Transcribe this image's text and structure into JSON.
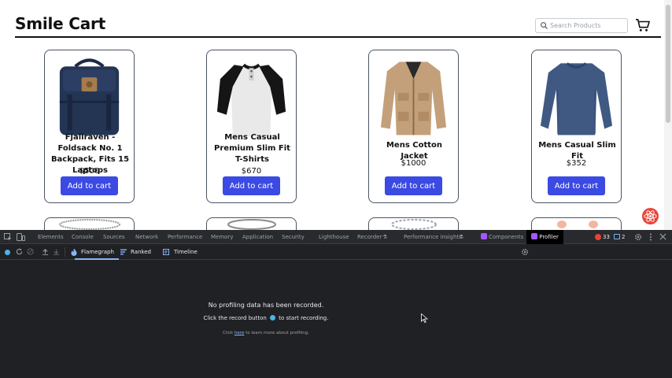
{
  "site": {
    "brand": "Smile Cart",
    "search_placeholder": "Search Products"
  },
  "products": [
    {
      "name": "Fjallraven - Foldsack No. 1 Backpack, Fits 15 Laptops",
      "price": "$500",
      "button": "Add to cart"
    },
    {
      "name": "Mens Casual Premium Slim Fit T-Shirts",
      "price": "$670",
      "button": "Add to cart"
    },
    {
      "name": "Mens Cotton Jacket",
      "price": "$1000",
      "button": "Add to cart"
    },
    {
      "name": "Mens Casual Slim Fit",
      "price": "$352",
      "button": "Add to cart"
    }
  ],
  "devtools": {
    "tabs": [
      "Elements",
      "Console",
      "Sources",
      "Network",
      "Performance",
      "Memory",
      "Application",
      "Security",
      "Lighthouse",
      "Recorder",
      "Performance insights",
      "Components",
      "Profiler"
    ],
    "error_count": "33",
    "message_count": "2"
  },
  "profiler": {
    "tabs": [
      "Flamegraph",
      "Ranked",
      "Timeline"
    ],
    "empty_title": "No profiling data has been recorded.",
    "empty_sub_before": "Click the record button",
    "empty_sub_after": "to start recording.",
    "link_before": "Click",
    "link_text": "here",
    "link_after": "to learn more about profiling."
  },
  "colors": {
    "accent_button": "#3b4ae3",
    "devtools_bg": "#202124",
    "record_dot": "#4fb3ea"
  }
}
